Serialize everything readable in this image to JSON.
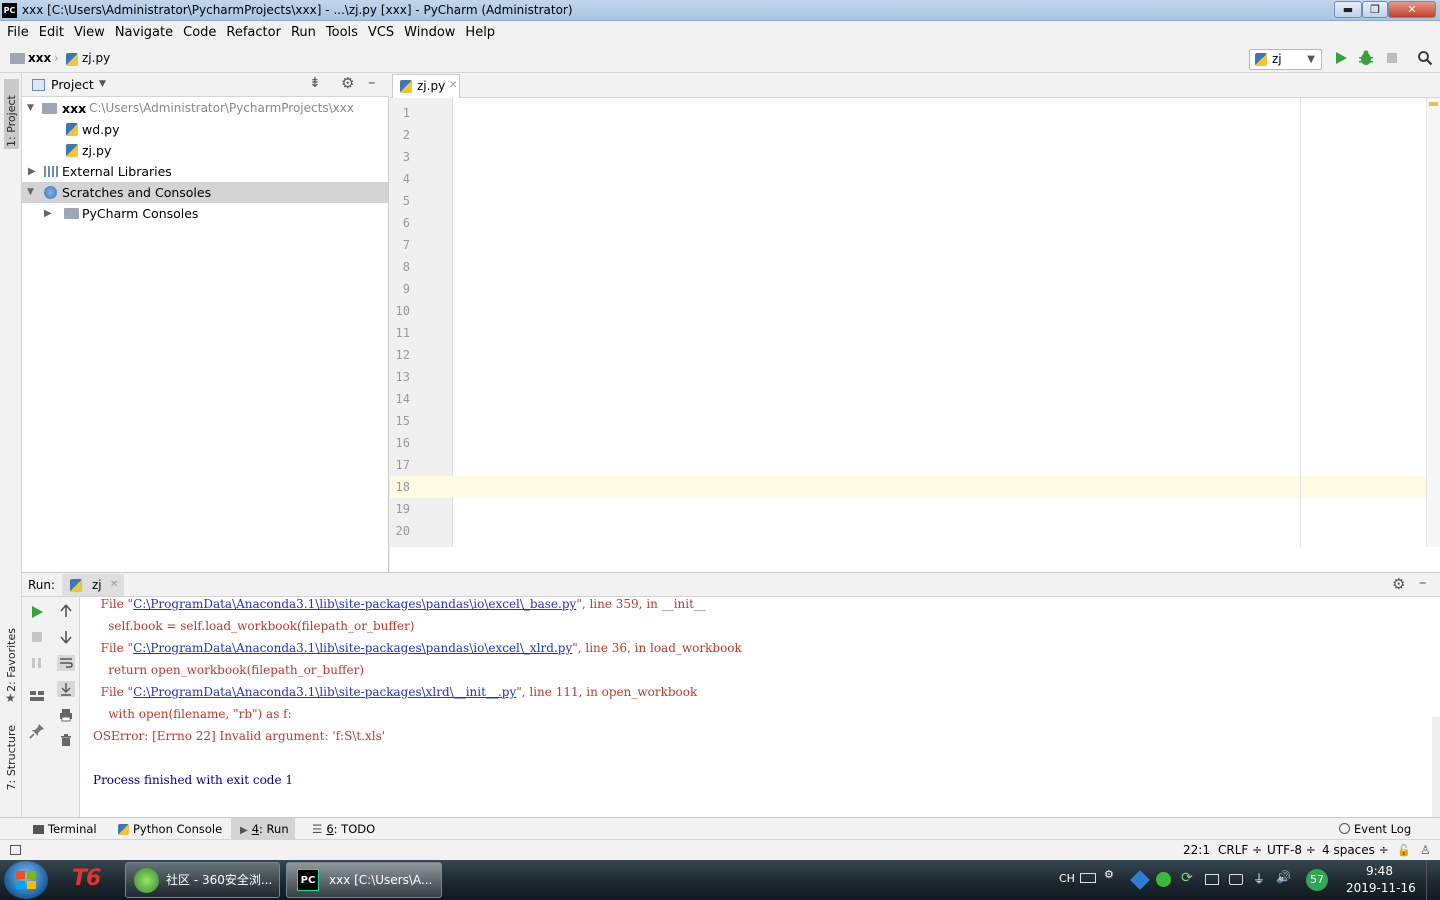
{
  "window": {
    "title": "xxx [C:\\Users\\Administrator\\PycharmProjects\\xxx] - ...\\zj.py [xxx] - PyCharm (Administrator)",
    "app_logo": "PC",
    "controls": {
      "minimize": "▬",
      "maximize": "❐",
      "close": "✕"
    }
  },
  "menu": [
    "File",
    "Edit",
    "View",
    "Navigate",
    "Code",
    "Refactor",
    "Run",
    "Tools",
    "VCS",
    "Window",
    "Help"
  ],
  "navbar": {
    "project": "xxx",
    "file": "zj.py",
    "run_config": "zj"
  },
  "left_stripe": {
    "project_tab": "1: Project",
    "favorites_tab": "2: Favorites",
    "structure_tab": "7: Structure"
  },
  "project_panel": {
    "title": "Project",
    "tree": [
      {
        "label": "xxx",
        "path": "C:\\Users\\Administrator\\PycharmProjects\\xxx"
      },
      {
        "label": "wd.py"
      },
      {
        "label": "zj.py"
      },
      {
        "label": "External Libraries"
      },
      {
        "label": "Scratches and Consoles"
      },
      {
        "label": "PyCharm Consoles"
      }
    ]
  },
  "editor": {
    "tab": "zj.py",
    "line_numbers": [
      "1",
      "2",
      "3",
      "4",
      "5",
      "6",
      "7",
      "8",
      "9",
      "10",
      "11",
      "12",
      "13",
      "14",
      "15",
      "16",
      "17",
      "18",
      "19",
      "20"
    ],
    "current_line": 18
  },
  "run_panel": {
    "label": "Run:",
    "tab": "zj",
    "console": [
      {
        "pre": "  File \"",
        "link": "C:\\ProgramData\\Anaconda3.1\\lib\\site-packages\\pandas\\io\\excel\\_base.py",
        "post": "\", line 359, in __init__"
      },
      {
        "text": "    self.book = self.load_workbook(filepath_or_buffer)"
      },
      {
        "pre": "  File \"",
        "link": "C:\\ProgramData\\Anaconda3.1\\lib\\site-packages\\pandas\\io\\excel\\_xlrd.py",
        "post": "\", line 36, in load_workbook"
      },
      {
        "text": "    return open_workbook(filepath_or_buffer)"
      },
      {
        "pre": "  File \"",
        "link": "C:\\ProgramData\\Anaconda3.1\\lib\\site-packages\\xlrd\\__init__.py",
        "post": "\", line 111, in open_workbook"
      },
      {
        "text": "    with open(filename, \"rb\") as f:"
      },
      {
        "text": "OSError: [Errno 22] Invalid argument: 'f:S\\t.xls'"
      },
      {
        "text": ""
      },
      {
        "text": "Process finished with exit code 1"
      }
    ]
  },
  "tool_tabs": {
    "terminal": "Terminal",
    "python_console": "Python Console",
    "run_num": "4",
    "run": ": Run",
    "todo_num": "6",
    "todo": ": TODO",
    "event_log": "Event Log"
  },
  "status_bar": {
    "position": "22:1",
    "line_sep": "CRLF ÷",
    "encoding": "UTF-8 ÷",
    "indent": "4 spaces ÷"
  },
  "taskbar": {
    "app_t6": "T6",
    "browser": "社区 - 360安全浏...",
    "pycharm": "xxx [C:\\Users\\A...",
    "ime": "CH",
    "badge": "57",
    "time": "9:48",
    "date": "2019-11-16"
  }
}
